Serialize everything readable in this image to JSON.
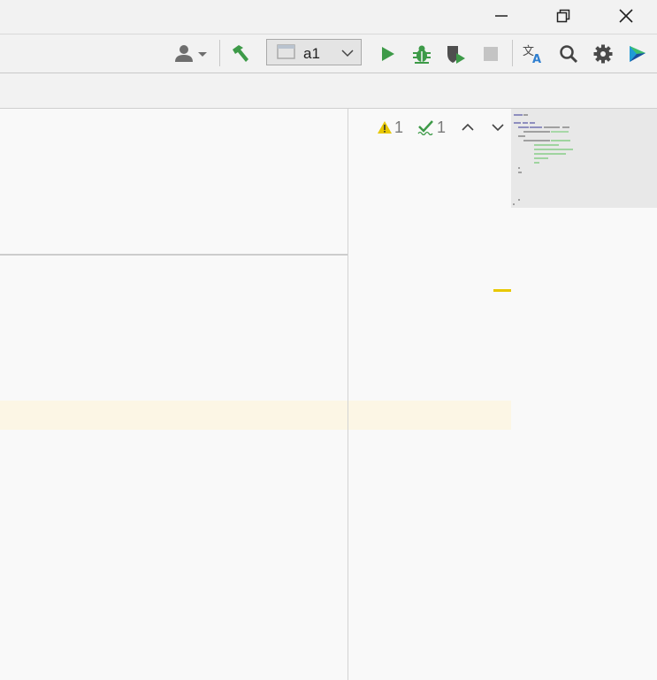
{
  "window": {
    "minimize_icon": "minimize-icon",
    "restore_icon": "restore-icon",
    "close_icon": "close-icon"
  },
  "toolbar": {
    "icons": [
      "user-icon",
      "hammer-icon",
      "run-icon",
      "debug-icon",
      "coverage-icon",
      "stop-icon",
      "translate-icon",
      "search-icon",
      "gear-icon",
      "plugin-logo-icon"
    ],
    "run_config_label": "a1"
  },
  "inspections": {
    "warnings": "1",
    "typos": "1"
  },
  "colors": {
    "run_green": "#3d9a48",
    "warning_yellow": "#e8c800",
    "highlight": "#fcf6e5"
  }
}
